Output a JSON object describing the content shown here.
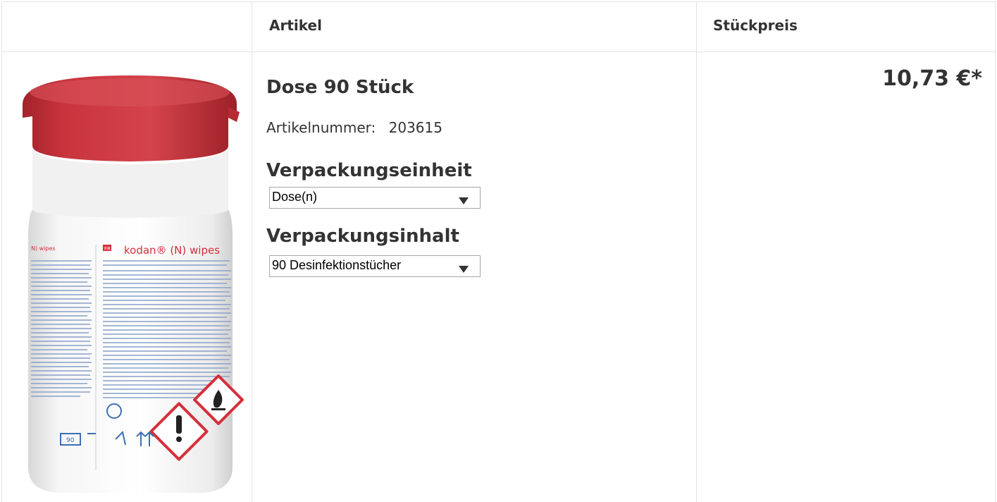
{
  "columns": {
    "article": "Artikel",
    "unit_price": "Stückpreis"
  },
  "product": {
    "title": "Dose 90 Stück",
    "sku_label": "Artikelnummer:",
    "sku_value": "203615",
    "image_label": "kodan® (N) wipes",
    "packaging_unit": {
      "label": "Verpackungseinheit",
      "selected": "Dose(n)"
    },
    "packaging_content": {
      "label": "Verpackungsinhalt",
      "selected": "90 Desinfektionstücher"
    },
    "price": "10,73 €*"
  },
  "colors": {
    "lid_red": "#c9343d",
    "body_white": "#f7f7f7",
    "brand_red": "#d42f3a",
    "grid_line": "#e3e3e3"
  }
}
